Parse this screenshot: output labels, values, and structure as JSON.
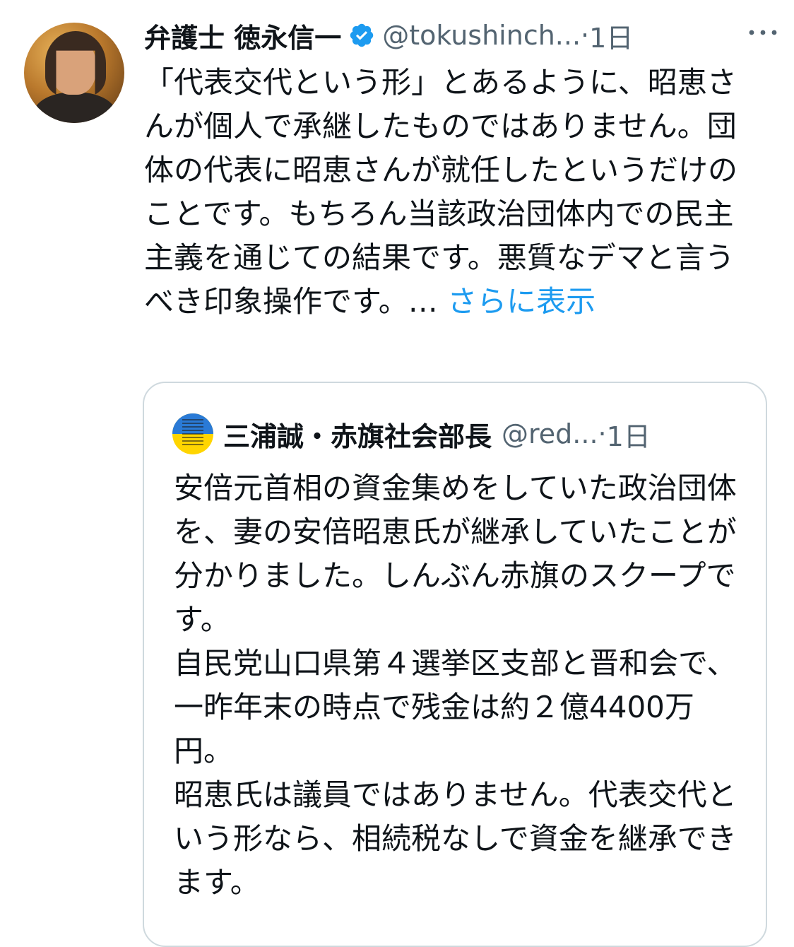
{
  "tweet": {
    "display_name": "弁護士 徳永信一",
    "handle": "@tokushinch...",
    "separator": "·",
    "time": "1日",
    "text": "「代表交代という形」とあるように、昭恵さんが個人で承継したものではありません。団体の代表に昭恵さんが就任したというだけのことです。もちろん当該政治団体内での民主主義を通じての結果です。悪質なデマと言うべき印象操作です。… ",
    "show_more": "さらに表示",
    "icons": {
      "avatar": "profile-photo",
      "verified": "verified-badge-icon",
      "more": "more-options-icon"
    }
  },
  "quote": {
    "display_name": "三浦誠・赤旗社会部長",
    "handle": "@red...",
    "separator": "·",
    "time": "1日",
    "text": "安倍元首相の資金集めをしていた政治団体を、妻の安倍昭恵氏が継承していたことが分かりました。しんぶん赤旗のスクープです。\n自民党山口県第４選挙区支部と晋和会で、一昨年末の時点で残金は約２億4400万円。\n昭恵氏は議員ではありません。代表交代という形なら、相続税なしで資金を継承できます。"
  },
  "colors": {
    "link": "#1d9bf0",
    "secondary_text": "#536471",
    "border": "#cfd9de",
    "verified": "#1d9bf0"
  }
}
